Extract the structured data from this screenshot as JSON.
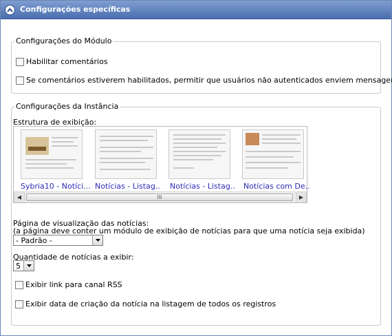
{
  "panel": {
    "title": "Configurações específicas",
    "header_color": "#5a7fc0"
  },
  "module_settings": {
    "legend": "Configurações do Módulo",
    "checkboxes": [
      {
        "label": "Habilitar comentários",
        "checked": false
      },
      {
        "label": "Se comentários estiverem habilitados, permitir que usuários não autenticados enviem mensagens",
        "checked": false
      }
    ]
  },
  "instance_settings": {
    "legend": "Configurações da Instância",
    "display_structure_label": "Estrutura de exibição:",
    "templates": [
      {
        "caption": "Sybria10 - Notíci...",
        "icon": "template-preview-icon"
      },
      {
        "caption": "Notícias - Listag..",
        "icon": "template-preview-icon"
      },
      {
        "caption": "Notícias - Listag..",
        "icon": "template-preview-icon"
      },
      {
        "caption": "Notícias com De..",
        "icon": "template-preview-icon"
      }
    ],
    "scrollbar_grip": "III",
    "page_label": "Página de visualização das notícias:",
    "page_hint": "(a página deve conter um módulo de exibição de notícias para que uma notícia seja exibida)",
    "page_select_value": "- Padrão -",
    "quantity_label": "Quantidade de notícias a exibir:",
    "quantity_value": "5",
    "checkboxes": [
      {
        "label": "Exibir link para canal RSS",
        "checked": false
      },
      {
        "label": "Exibir data de criação da notícia na listagem de todos os registros",
        "checked": false
      }
    ]
  }
}
